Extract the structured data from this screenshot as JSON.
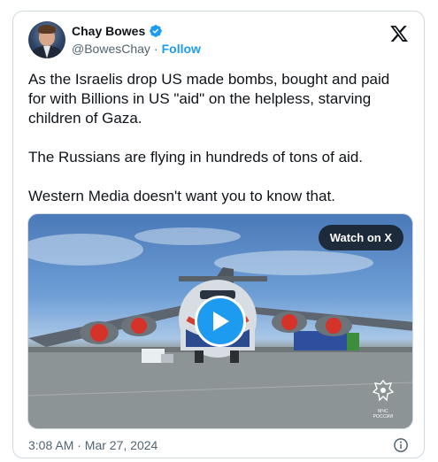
{
  "author": {
    "name": "Chay Bowes",
    "handle": "@BowesChay",
    "separator": "·",
    "follow_label": "Follow"
  },
  "tweet": {
    "text": "As the Israelis drop US made bombs, bought and paid for with Billions in US \"aid\" on the helpless, starving children of Gaza.\n\nThe Russians are flying in hundreds of tons of aid.\n\nWestern Media doesn't want you to know that."
  },
  "media": {
    "watch_label": "Watch on X",
    "emblem_text": "МЧС РОССИИ"
  },
  "footer": {
    "timestamp": "3:08 AM · Mar 27, 2024"
  },
  "icons": {
    "verified": "verified-badge-icon",
    "platform": "x-logo-icon",
    "play": "play-icon",
    "info": "info-icon"
  },
  "colors": {
    "accent": "#1d9bf0",
    "text": "#0f1419",
    "muted": "#536471",
    "border": "#cfd9de"
  }
}
